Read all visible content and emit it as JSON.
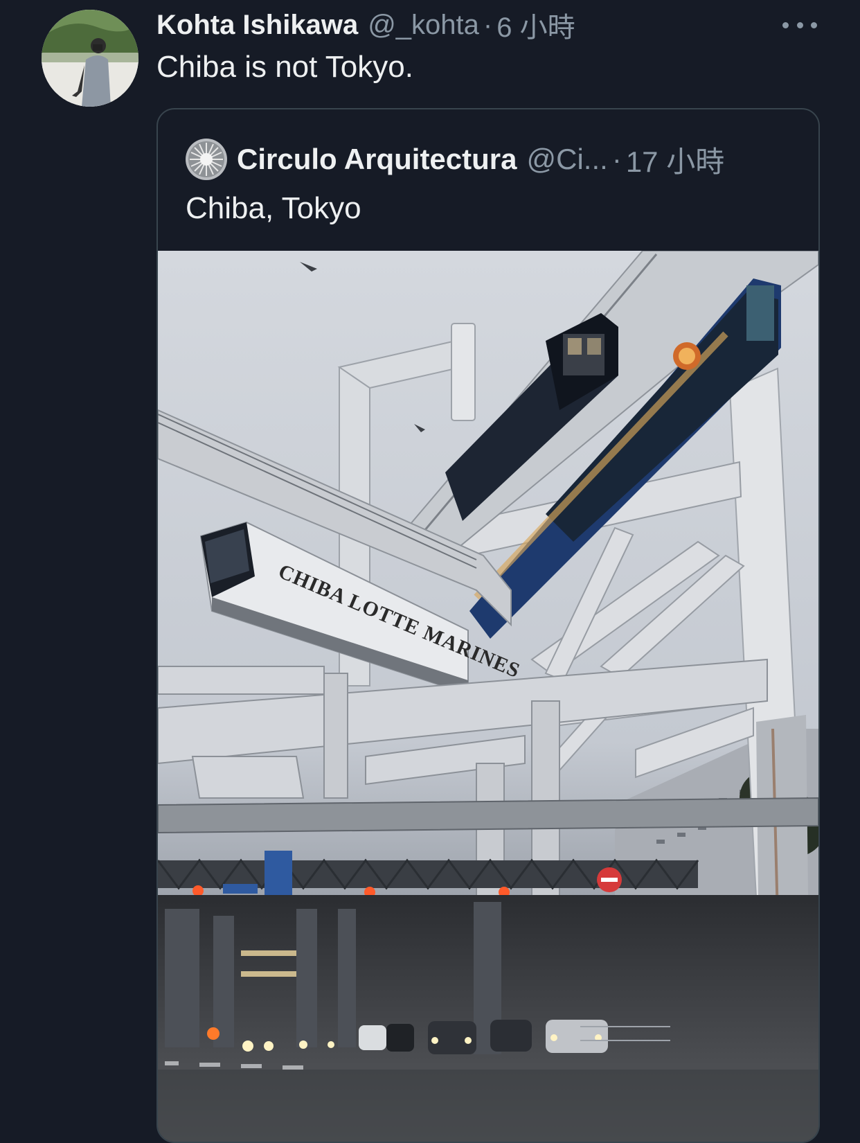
{
  "tweet": {
    "author_name": "Kohta Ishikawa",
    "author_handle": "@_kohta",
    "separator": "·",
    "time": "6 小時",
    "text": "Chiba is not Tokyo.",
    "more_icon": "more-horizontal-icon"
  },
  "quoted_tweet": {
    "author_name": "Circulo Arquitectura",
    "author_handle": "@Ci...",
    "separator": "·",
    "time": "17 小時",
    "text": "Chiba, Tokyo",
    "photo_sign_text": "CHIBA LOTTE MARINES"
  },
  "colors": {
    "background": "#161b26",
    "primary_text": "#e7e9ea",
    "secondary_text": "#8b98a5",
    "border": "#38444d"
  }
}
